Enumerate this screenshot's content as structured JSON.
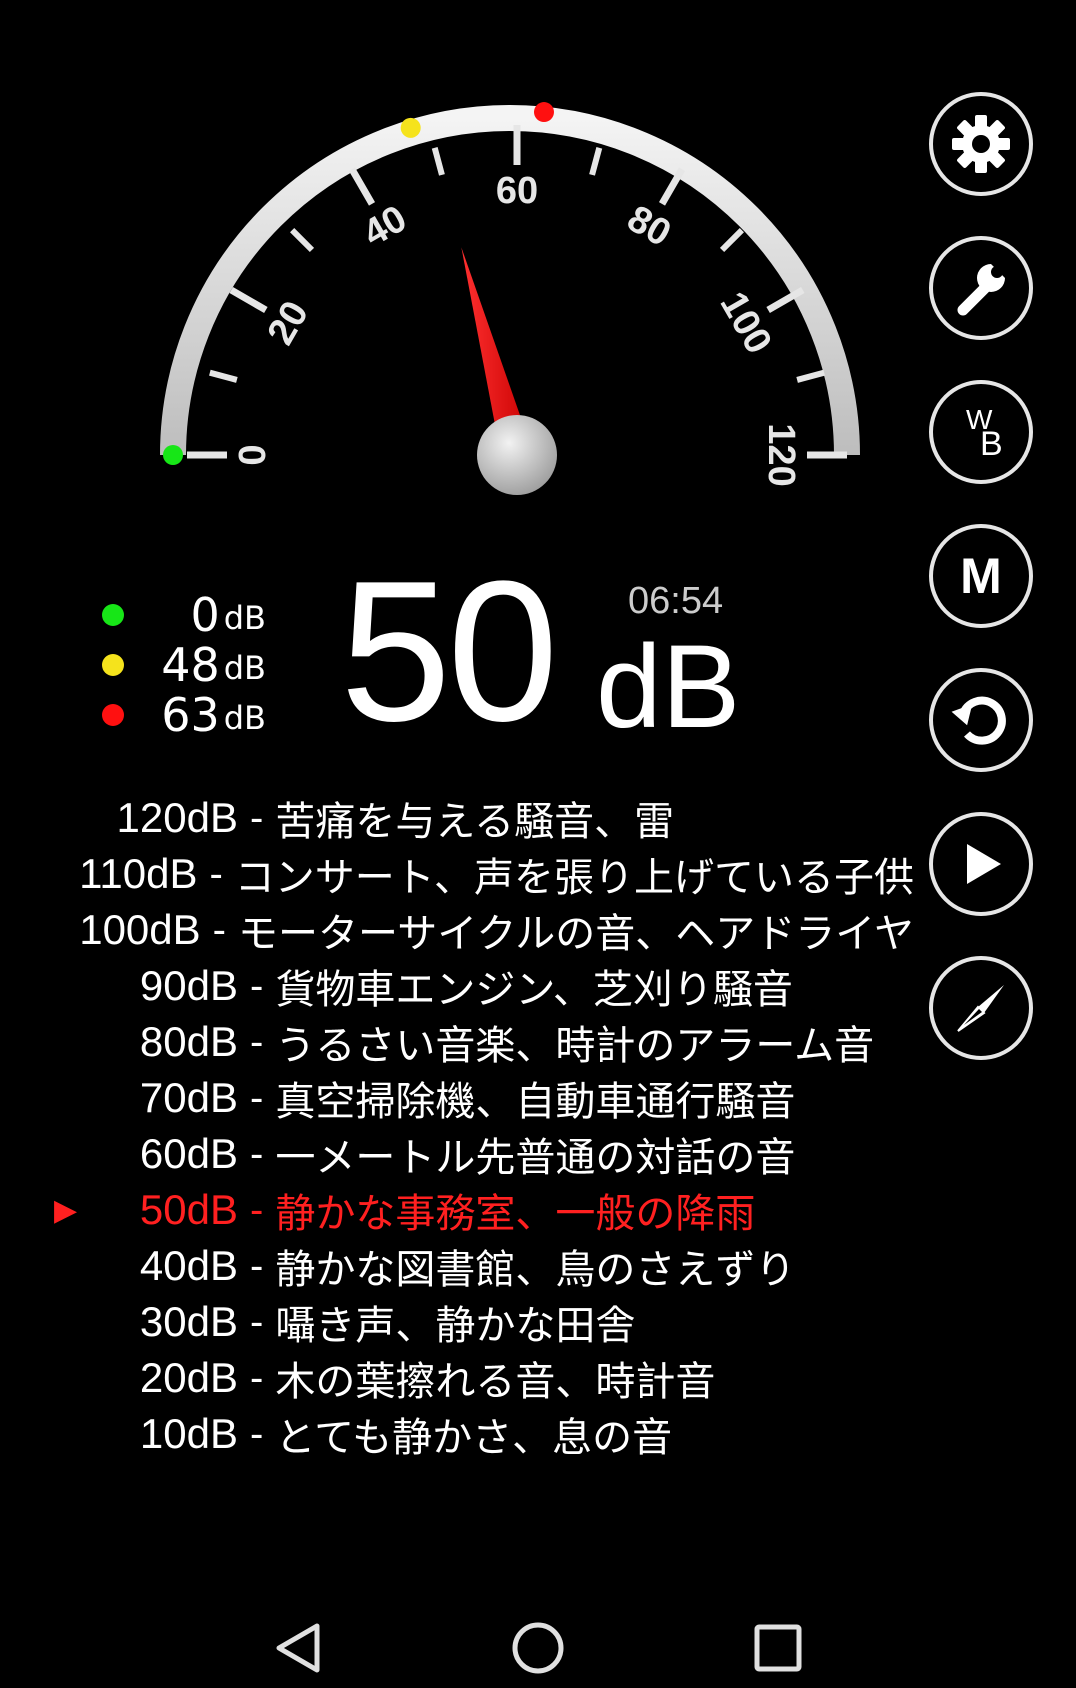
{
  "gauge": {
    "min": 0,
    "max": 120,
    "needle_value": 50,
    "tick_labels": [
      "0",
      "20",
      "40",
      "60",
      "80",
      "100",
      "120"
    ],
    "min_marker_value": 0,
    "avg_marker_value": 48,
    "max_marker_value": 63
  },
  "colors": {
    "min": "#17e617",
    "avg": "#f5e31c",
    "max": "#ff1010",
    "active_row": "#ff2020"
  },
  "stats": {
    "min": {
      "value": "0",
      "unit": "dB"
    },
    "avg": {
      "value": "48",
      "unit": "dB"
    },
    "max": {
      "value": "63",
      "unit": "dB"
    }
  },
  "current": {
    "value": "50",
    "unit": "dB",
    "elapsed": "06:54"
  },
  "side_buttons": [
    {
      "icon": "gear-icon"
    },
    {
      "icon": "wrench-icon"
    },
    {
      "icon": "white-balance-icon",
      "label_top": "W",
      "label_bottom": "B"
    },
    {
      "icon": "m-icon",
      "label": "M"
    },
    {
      "icon": "reset-icon"
    },
    {
      "icon": "play-icon"
    },
    {
      "icon": "compass-icon"
    }
  ],
  "reference": {
    "active_marker": "▶",
    "separator": "-",
    "rows": [
      {
        "level": "120dB",
        "desc": "苦痛を与える騒音、雷"
      },
      {
        "level": "110dB",
        "desc": "コンサート、声を張り上げている子供"
      },
      {
        "level": "100dB",
        "desc": "モーターサイクルの音、ヘアドライヤ"
      },
      {
        "level": "90dB",
        "desc": "貨物車エンジン、芝刈り騒音"
      },
      {
        "level": "80dB",
        "desc": "うるさい音楽、時計のアラーム音"
      },
      {
        "level": "70dB",
        "desc": "真空掃除機、自動車通行騒音"
      },
      {
        "level": "60dB",
        "desc": "一メートル先普通の対話の音"
      },
      {
        "level": "50dB",
        "desc": "静かな事務室、一般の降雨",
        "active": true
      },
      {
        "level": "40dB",
        "desc": "静かな図書館、鳥のさえずり"
      },
      {
        "level": "30dB",
        "desc": "囁き声、静かな田舎"
      },
      {
        "level": "20dB",
        "desc": "木の葉擦れる音、時計音"
      },
      {
        "level": "10dB",
        "desc": "とても静かさ、息の音"
      }
    ]
  },
  "nav": {
    "back_icon": "back-triangle-icon",
    "home_icon": "home-circle-icon",
    "recents_icon": "recents-square-icon"
  }
}
